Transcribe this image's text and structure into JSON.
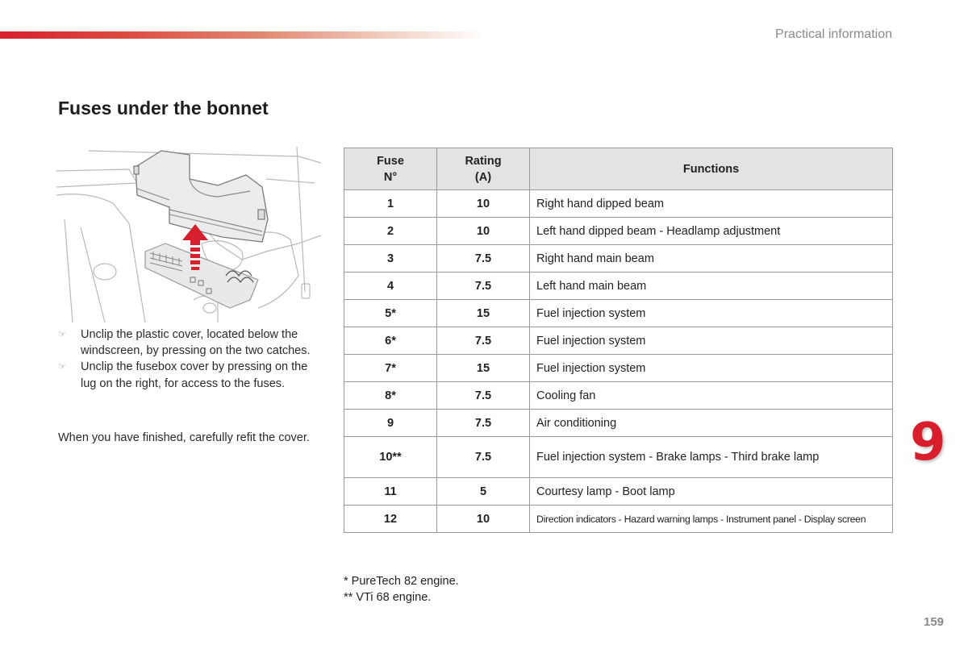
{
  "header": {
    "section": "Practical information",
    "accent_color": "#d6202e"
  },
  "page": {
    "title": "Fuses under the bonnet",
    "chapter_number": "9",
    "page_number": "159"
  },
  "illustration": {
    "description": "Engine bay fusebox with cover being lifted, red arrow pointing up",
    "arrow_color": "#d6202e"
  },
  "instructions": {
    "bullet_icon": "pointing-hand-icon",
    "steps": [
      "Unclip the plastic cover, located below the windscreen, by pressing on the two catches.",
      "Unclip the fusebox cover by pressing on the lug on the right, for access to the fuses."
    ],
    "note": "When you have finished, carefully refit the cover."
  },
  "table": {
    "headers": {
      "fuse_line1": "Fuse",
      "fuse_line2": "N°",
      "rating_line1": "Rating",
      "rating_line2": "(A)",
      "functions": "Functions"
    },
    "rows": [
      {
        "fuse": "1",
        "rating": "10",
        "function": "Right hand dipped beam"
      },
      {
        "fuse": "2",
        "rating": "10",
        "function": "Left hand dipped beam - Headlamp adjustment"
      },
      {
        "fuse": "3",
        "rating": "7.5",
        "function": "Right hand main beam"
      },
      {
        "fuse": "4",
        "rating": "7.5",
        "function": "Left hand main beam"
      },
      {
        "fuse": "5*",
        "rating": "15",
        "function": "Fuel injection system"
      },
      {
        "fuse": "6*",
        "rating": "7.5",
        "function": "Fuel injection system"
      },
      {
        "fuse": "7*",
        "rating": "15",
        "function": "Fuel injection system"
      },
      {
        "fuse": "8*",
        "rating": "7.5",
        "function": "Cooling fan"
      },
      {
        "fuse": "9",
        "rating": "7.5",
        "function": "Air conditioning"
      },
      {
        "fuse": "10**",
        "rating": "7.5",
        "function": "Fuel injection system - Brake lamps - Third brake lamp"
      },
      {
        "fuse": "11",
        "rating": "5",
        "function": "Courtesy lamp - Boot lamp"
      },
      {
        "fuse": "12",
        "rating": "10",
        "function": "Direction indicators - Hazard warning lamps - Instrument panel - Display screen"
      }
    ]
  },
  "footnotes": [
    "* PureTech 82 engine.",
    "** VTi 68 engine."
  ]
}
